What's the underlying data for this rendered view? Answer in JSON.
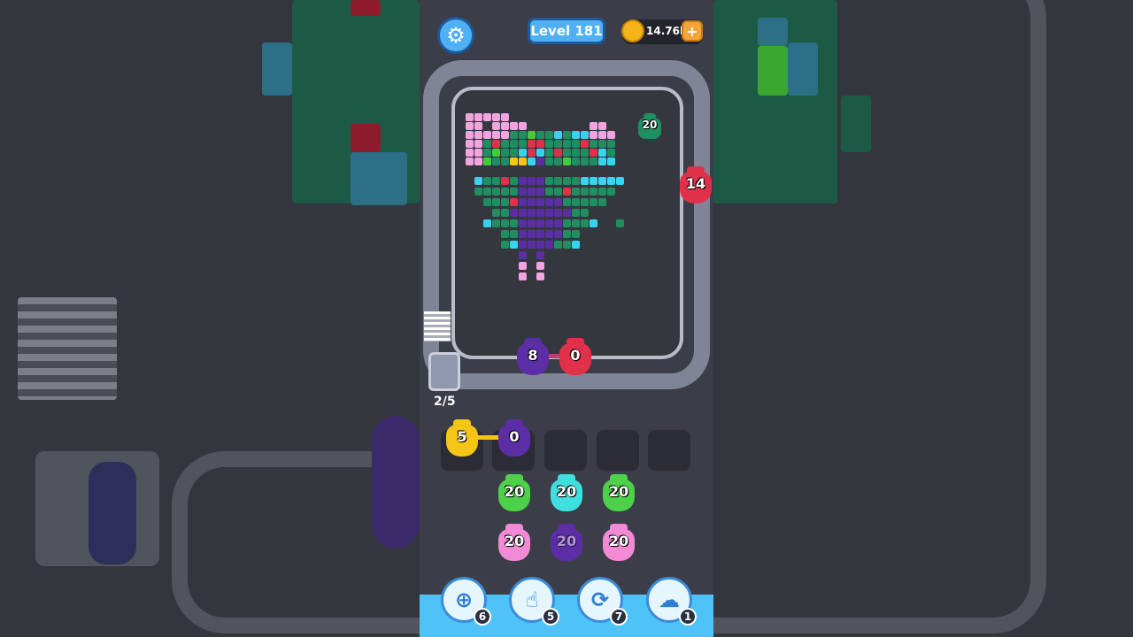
{
  "header": {
    "level_label": "Level 181",
    "coins": "14.76k",
    "coin_plus": "+"
  },
  "conveyor": {
    "queue_counter": "2/5",
    "track_blobs": [
      {
        "color": "#5b2ea6",
        "count": "8"
      },
      {
        "color": "#e0304a",
        "count": "0"
      }
    ],
    "side_blobs": [
      {
        "color": "#1f8f62",
        "count": "20"
      },
      {
        "color": "#e0304a",
        "count": "14"
      }
    ]
  },
  "tray": {
    "slots": [
      {
        "color": "#f5c518",
        "count": "5"
      },
      {
        "color": "#5b2ea6",
        "count": "0"
      },
      {
        "color": "",
        "count": ""
      },
      {
        "color": "",
        "count": ""
      },
      {
        "color": "",
        "count": ""
      }
    ]
  },
  "reserve": {
    "columns": [
      [
        {
          "color": "#4dd14a",
          "count": "20"
        },
        {
          "color": "#f28ad6",
          "count": "20"
        }
      ],
      [
        {
          "color": "#3fdfe0",
          "count": "20"
        },
        {
          "color": "#5b2ea6",
          "count": "20"
        }
      ],
      [
        {
          "color": "#4dd14a",
          "count": "20"
        },
        {
          "color": "#f28ad6",
          "count": "20"
        }
      ]
    ]
  },
  "powerups": [
    {
      "icon": "add-slot-icon",
      "count": "6"
    },
    {
      "icon": "hand-icon",
      "count": "5"
    },
    {
      "icon": "shuffle-icon",
      "count": "7"
    },
    {
      "icon": "vacuum-icon",
      "count": "1"
    }
  ],
  "colors": {
    "pink": "#f3a3e0",
    "green": "#1f8f62",
    "lime": "#3ccf3a",
    "cyan": "#38d4ef",
    "purple": "#5b2ea6",
    "red": "#e0304a",
    "yellow": "#f5c518"
  }
}
